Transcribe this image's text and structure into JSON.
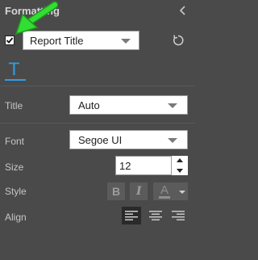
{
  "header": {
    "title": "Formatting",
    "collapse_icon": "chevron-left-icon"
  },
  "title_row": {
    "checked": true,
    "select_value": "Report Title",
    "reset_icon": "reset-icon",
    "pointer_color": "#22dd22"
  },
  "tabs": {
    "text_tab_label": "T"
  },
  "title_field": {
    "label": "Title",
    "value": "Auto"
  },
  "font_field": {
    "label": "Font",
    "value": "Segoe UI"
  },
  "size_field": {
    "label": "Size",
    "value": "12"
  },
  "style_field": {
    "label": "Style",
    "bold_label": "B",
    "italic_label": "I",
    "color_label": "A"
  },
  "align_field": {
    "label": "Align",
    "selected": "left"
  },
  "colors": {
    "accent": "#2f9ee8",
    "background": "#4a4a4a"
  }
}
